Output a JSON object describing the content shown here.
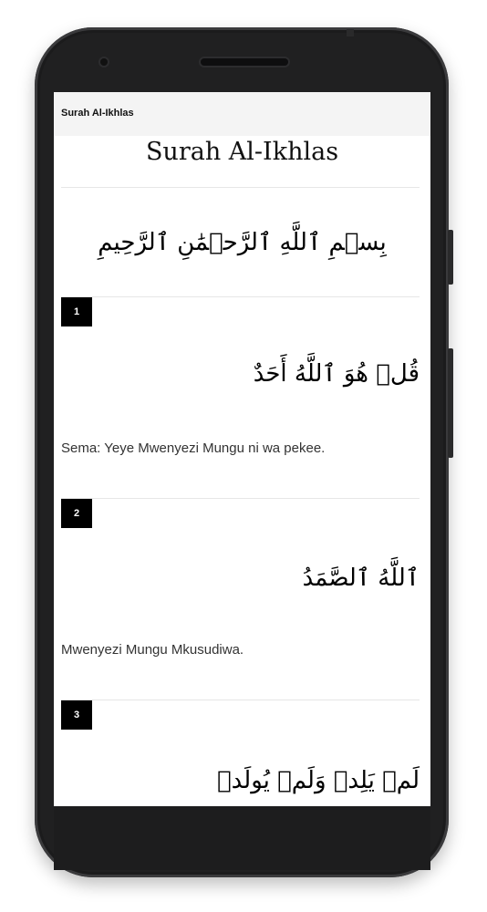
{
  "app": {
    "appbar_title": "Surah Al-Ikhlas"
  },
  "surah": {
    "heading": "Surah Al-Ikhlas",
    "basmala": "بِسۡمِ ٱللَّهِ ٱلرَّحۡمَٰنِ ٱلرَّحِيمِ"
  },
  "verses": [
    {
      "number": "1",
      "arabic": "قُلۡ هُوَ ٱللَّهُ أَحَدٌ",
      "translation": "Sema: Yeye Mwenyezi Mungu ni wa pekee."
    },
    {
      "number": "2",
      "arabic": "ٱللَّهُ ٱلصَّمَدُ",
      "translation": "Mwenyezi Mungu Mkusudiwa."
    },
    {
      "number": "3",
      "arabic": "لَمۡ يَلِدۡ وَلَمۡ يُولَدۡ",
      "translation": ""
    }
  ]
}
